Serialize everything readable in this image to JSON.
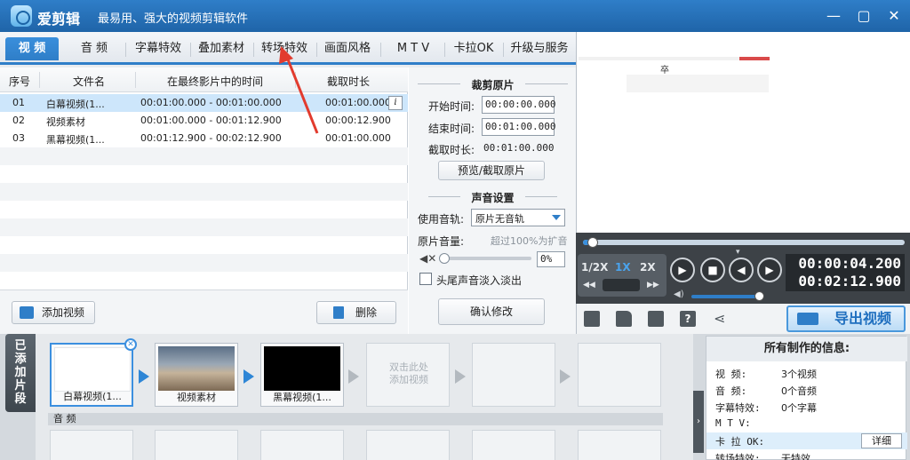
{
  "app": {
    "title": "爱剪辑",
    "subtitle": "最易用、强大的视频剪辑软件",
    "window_controls": [
      "minimize-icon",
      "maximize-icon",
      "close-icon"
    ]
  },
  "tabs": [
    {
      "label": "视 频",
      "active": true
    },
    {
      "label": "音 频"
    },
    {
      "label": "字幕特效"
    },
    {
      "label": "叠加素材"
    },
    {
      "label": "转场特效"
    },
    {
      "label": "画面风格"
    },
    {
      "label": "M T V"
    },
    {
      "label": "卡拉OK"
    },
    {
      "label": "升级与服务"
    }
  ],
  "clip_list": {
    "headers": [
      "序号",
      "文件名",
      "在最终影片中的时间",
      "截取时长"
    ],
    "rows": [
      {
        "index": "01",
        "name": "白幕视频(1...",
        "range": "00:01:00.000 - 00:01:00.000",
        "duration": "00:01:00.000"
      },
      {
        "index": "02",
        "name": "视频素材",
        "range": "00:01:00.000 - 00:01:12.900",
        "duration": "00:00:12.900"
      },
      {
        "index": "03",
        "name": "黑幕视频(1...",
        "range": "00:01:12.900 - 00:02:12.900",
        "duration": "00:01:00.000"
      }
    ],
    "info_button": "i",
    "add_button": "添加视频",
    "delete_button": "删除"
  },
  "trim": {
    "section_title": "裁剪原片",
    "start_label": "开始时间:",
    "start_value": "00:00:00.000",
    "end_label": "结束时间:",
    "end_value": "00:01:00.000",
    "length_label": "截取时长:",
    "length_value": "00:01:00.000",
    "preview_button": "预览/截取原片",
    "sound_title": "声音设置",
    "track_label": "使用音轨:",
    "track_value": "原片无音轨",
    "volume_label": "原片音量:",
    "volume_hint": "超过100%为扩音",
    "volume_value": "0%",
    "volume_level": 0,
    "fade_label": "头尾声音淡入淡出",
    "fade_checked": false,
    "confirm_button": "确认修改"
  },
  "preview": {
    "overlay_char": "卒"
  },
  "player": {
    "speeds": [
      "1/2X",
      "1X",
      "2X"
    ],
    "current_time": "00:00:04.200",
    "total_time": "00:02:12.900",
    "progress": 0.03,
    "volume": 0.95
  },
  "toolbar": {
    "icons": [
      "new-project-icon",
      "open-folder-icon",
      "save-icon",
      "help-icon",
      "share-icon"
    ],
    "export_label": "导出视频"
  },
  "timeline": {
    "side_label": "已添加片段",
    "clips": [
      {
        "caption": "白幕视频(1...",
        "kind": "white",
        "selected": true
      },
      {
        "caption": "视频素材",
        "kind": "sky"
      },
      {
        "caption": "黑幕视频(1...",
        "kind": "black"
      }
    ],
    "add_hint": "双击此处\n添加视频",
    "audio_label": "音 频"
  },
  "info_panel": {
    "title": "所有制作的信息:",
    "rows": [
      {
        "key": "视   频:",
        "value": "3个视频"
      },
      {
        "key": "音   频:",
        "value": "0个音频"
      },
      {
        "key": "字幕特效:",
        "value": "0个字幕"
      },
      {
        "key": "M  T  V:",
        "value": ""
      },
      {
        "key": "卡 拉 OK:",
        "value": "",
        "highlight": true
      },
      {
        "key": "转场特效:",
        "value": "无特效"
      }
    ],
    "detail_button": "详细"
  },
  "colors": {
    "accent": "#2f7ec8",
    "annotation_arrow": "#e23b2e"
  }
}
